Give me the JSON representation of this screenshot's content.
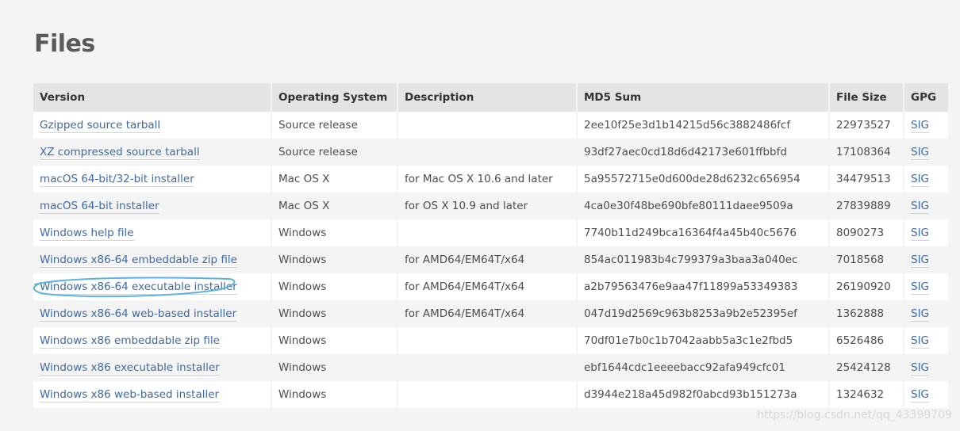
{
  "page_title": "Files",
  "columns": [
    "Version",
    "Operating System",
    "Description",
    "MD5 Sum",
    "File Size",
    "GPG"
  ],
  "rows": [
    {
      "version": "Gzipped source tarball",
      "os": "Source release",
      "description": "",
      "md5": "2ee10f25e3d1b14215d56c3882486fcf",
      "size": "22973527",
      "gpg": "SIG"
    },
    {
      "version": "XZ compressed source tarball",
      "os": "Source release",
      "description": "",
      "md5": "93df27aec0cd18d6d42173e601ffbbfd",
      "size": "17108364",
      "gpg": "SIG"
    },
    {
      "version": "macOS 64-bit/32-bit installer",
      "os": "Mac OS X",
      "description": "for Mac OS X 10.6 and later",
      "md5": "5a95572715e0d600de28d6232c656954",
      "size": "34479513",
      "gpg": "SIG"
    },
    {
      "version": "macOS 64-bit installer",
      "os": "Mac OS X",
      "description": "for OS X 10.9 and later",
      "md5": "4ca0e30f48be690bfe80111daee9509a",
      "size": "27839889",
      "gpg": "SIG"
    },
    {
      "version": "Windows help file",
      "os": "Windows",
      "description": "",
      "md5": "7740b11d249bca16364f4a45b40c5676",
      "size": "8090273",
      "gpg": "SIG"
    },
    {
      "version": "Windows x86-64 embeddable zip file",
      "os": "Windows",
      "description": "for AMD64/EM64T/x64",
      "md5": "854ac011983b4c799379a3baa3a040ec",
      "size": "7018568",
      "gpg": "SIG"
    },
    {
      "version": "Windows x86-64 executable installer",
      "os": "Windows",
      "description": "for AMD64/EM64T/x64",
      "md5": "a2b79563476e9aa47f11899a53349383",
      "size": "26190920",
      "gpg": "SIG"
    },
    {
      "version": "Windows x86-64 web-based installer",
      "os": "Windows",
      "description": "for AMD64/EM64T/x64",
      "md5": "047d19d2569c963b8253a9b2e52395ef",
      "size": "1362888",
      "gpg": "SIG"
    },
    {
      "version": "Windows x86 embeddable zip file",
      "os": "Windows",
      "description": "",
      "md5": "70df01e7b0c1b7042aabb5a3c1e2fbd5",
      "size": "6526486",
      "gpg": "SIG"
    },
    {
      "version": "Windows x86 executable installer",
      "os": "Windows",
      "description": "",
      "md5": "ebf1644cdc1eeeebacc92afa949cfc01",
      "size": "25424128",
      "gpg": "SIG"
    },
    {
      "version": "Windows x86 web-based installer",
      "os": "Windows",
      "description": "",
      "md5": "d3944e218a45d982f0abcd93b151273a",
      "size": "1324632",
      "gpg": "SIG"
    }
  ],
  "colors": {
    "link": "#3d6aa5",
    "underline": "#f3d673",
    "highlight_circle": "#5bb4e0",
    "header_bg": "#e4e4e4"
  },
  "watermark": "https://blog.csdn.net/qq_43399709"
}
